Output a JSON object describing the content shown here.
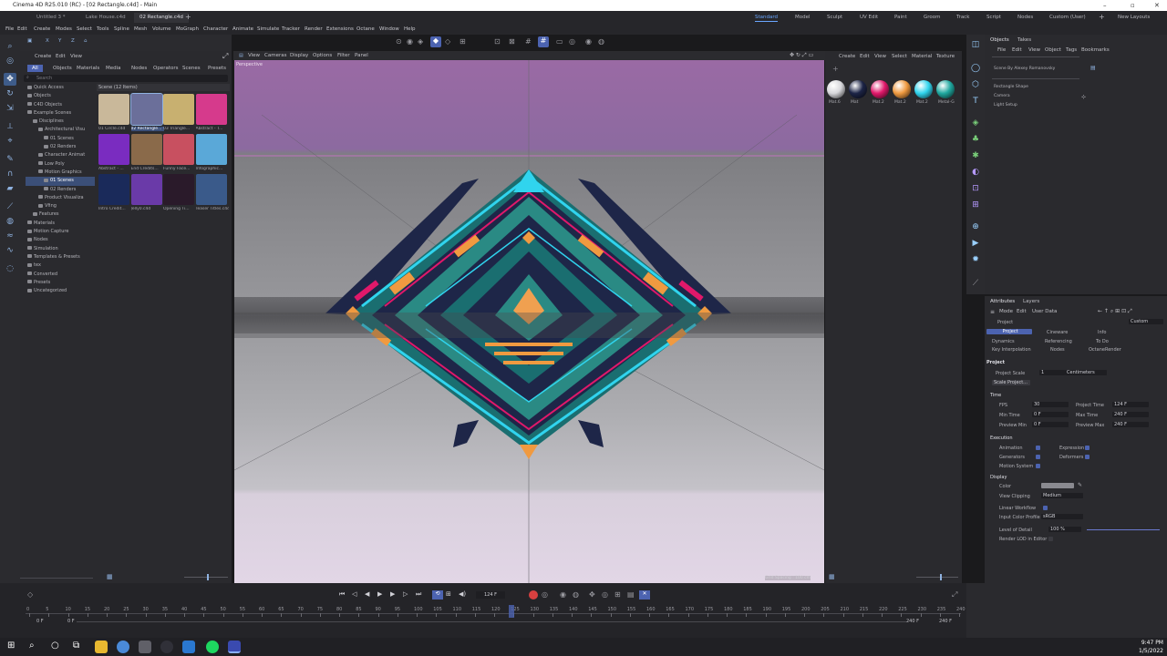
{
  "window": {
    "title": "Cinema 4D R25.010 (RC) - [02 Rectangle.c4d] - Main"
  },
  "doc_tabs": [
    "Untitled 3 *",
    "Lake House.c4d",
    "02 Rectangle.c4d"
  ],
  "layouts": [
    "Standard",
    "Model",
    "Sculpt",
    "UV Edit",
    "Paint",
    "Groom",
    "Track",
    "Script",
    "Nodes",
    "Custom (User)",
    "New Layouts"
  ],
  "menu": [
    "File",
    "Edit",
    "Create",
    "Modes",
    "Select",
    "Tools",
    "Spline",
    "Mesh",
    "Volume",
    "MoGraph",
    "Character",
    "Animate",
    "Simulate",
    "Tracker",
    "Render",
    "Extensions",
    "Octane",
    "Window",
    "Help"
  ],
  "asset_panel": {
    "menu": [
      "Create",
      "Edit",
      "View"
    ],
    "filters": [
      "All",
      "Objects",
      "Materials",
      "Media",
      "Nodes",
      "Operators",
      "Scenes",
      "Presets"
    ],
    "search_placeholder": "Search",
    "scenes_header": "Scene (12 Items)",
    "tree": [
      "Quick Access",
      "Objects",
      "C4D Objects",
      "Example Scenes",
      "Disciplines",
      "Architectural Visu",
      "01 Scenes",
      "02 Renders",
      "Character Animat",
      "Low Poly",
      "Motion Graphics",
      "01 Scenes",
      "02 Renders",
      "Product Visualiza",
      "Vfing",
      "Features",
      "Materials",
      "Motion Capture",
      "Nodes",
      "Simulation",
      "Templates & Presets",
      "tex",
      "Converted",
      "Presets",
      "Uncategorized"
    ],
    "thumbs": [
      "01 Circle.c4d",
      "02 Rectangle...",
      "03 Triangle...",
      "Abstract - T...",
      "Abstract - ...",
      "End Credits...",
      "Funny Face...",
      "Infographic...",
      "Intro Credit...",
      "Jelly0.c4d",
      "Opening Ti...",
      "Teaser Titles.c4d"
    ],
    "thumb_colors": [
      "#c9b89a",
      "#6b6f9a",
      "#c8b070",
      "#d63a8c",
      "#7a2cc0",
      "#8a6a4a",
      "#c85060",
      "#5aa8d8",
      "#1a2a5a",
      "#6a3aa8",
      "#2a1a2a",
      "#3a5a8a"
    ]
  },
  "viewport": {
    "menu": [
      "View",
      "Cameras",
      "Display",
      "Options",
      "Filter",
      "Panel"
    ],
    "label": "Perspective",
    "grid_spacing": "Grid Spacing : 100 cm"
  },
  "materials": {
    "menu": [
      "Create",
      "Edit",
      "View",
      "Select",
      "Material",
      "Texture"
    ],
    "items": [
      {
        "label": "Mat.6",
        "color": "#d8d8dc"
      },
      {
        "label": "Mat",
        "color": "#1c2446"
      },
      {
        "label": "Mat.2",
        "color": "#e0186a"
      },
      {
        "label": "Mat.2",
        "color": "#f09a40"
      },
      {
        "label": "Mat.2",
        "color": "#30d4ee"
      },
      {
        "label": "Metal-G",
        "color": "#20a8a0"
      }
    ]
  },
  "objects": {
    "tabs": [
      "Objects",
      "Takes"
    ],
    "menu": [
      "File",
      "Edit",
      "View",
      "Object",
      "Tags",
      "Bookmarks"
    ],
    "items": [
      "Scene By Alexey Romanovsky",
      "Rectangle Shape",
      "Camera",
      "Light Setup"
    ]
  },
  "attributes": {
    "tabs": [
      "Attributes",
      "Layers"
    ],
    "menu": [
      "Mode",
      "Edit",
      "User Data"
    ],
    "section": "Project",
    "preset": "Custom",
    "subtabs": [
      "Project",
      "Cineware",
      "Info",
      "Dynamics",
      "Referencing",
      "To Do",
      "Key Interpolation",
      "Nodes",
      "OctaneRender"
    ],
    "project_scale_label": "Project Scale",
    "project_scale": "1",
    "project_scale_unit": "Centimeters",
    "scale_button": "Scale Project...",
    "time_header": "Time",
    "fps_label": "FPS",
    "fps": "30",
    "project_time_label": "Project Time",
    "project_time": "124 F",
    "min_time_label": "Min Time",
    "min_time": "0 F",
    "max_time_label": "Max Time",
    "max_time": "240 F",
    "preview_min_label": "Preview Min",
    "preview_min": "0 F",
    "preview_max_label": "Preview Max",
    "preview_max": "240 F",
    "execution_header": "Execution",
    "animation": "Animation",
    "expression": "Expression",
    "generators": "Generators",
    "deformers": "Deformers",
    "motion_system": "Motion System",
    "display_header": "Display",
    "color_label": "Color",
    "view_clipping_label": "View Clipping",
    "view_clipping": "Medium",
    "linear_workflow": "Linear Workflow",
    "input_color_profile_label": "Input Color Profile",
    "input_color_profile": "sRGB",
    "lod_label": "Level of Detail",
    "lod": "100 %",
    "render_lod": "Render LOD in Editor"
  },
  "timeline": {
    "current_frame": "124 F",
    "start": "0 F",
    "start2": "0 F",
    "end": "240 F",
    "end2": "240 F",
    "ticks": [
      "0",
      "5",
      "10",
      "15",
      "20",
      "25",
      "30",
      "35",
      "40",
      "45",
      "50",
      "55",
      "60",
      "65",
      "70",
      "75",
      "80",
      "85",
      "90",
      "95",
      "100",
      "105",
      "110",
      "115",
      "120",
      "125",
      "130",
      "135",
      "140",
      "145",
      "150",
      "155",
      "160",
      "165",
      "170",
      "175",
      "180",
      "185",
      "190",
      "195",
      "200",
      "205",
      "210",
      "215",
      "220",
      "225",
      "230",
      "235",
      "240"
    ]
  },
  "taskbar": {
    "time": "9:47 PM",
    "date": "1/5/2022"
  }
}
